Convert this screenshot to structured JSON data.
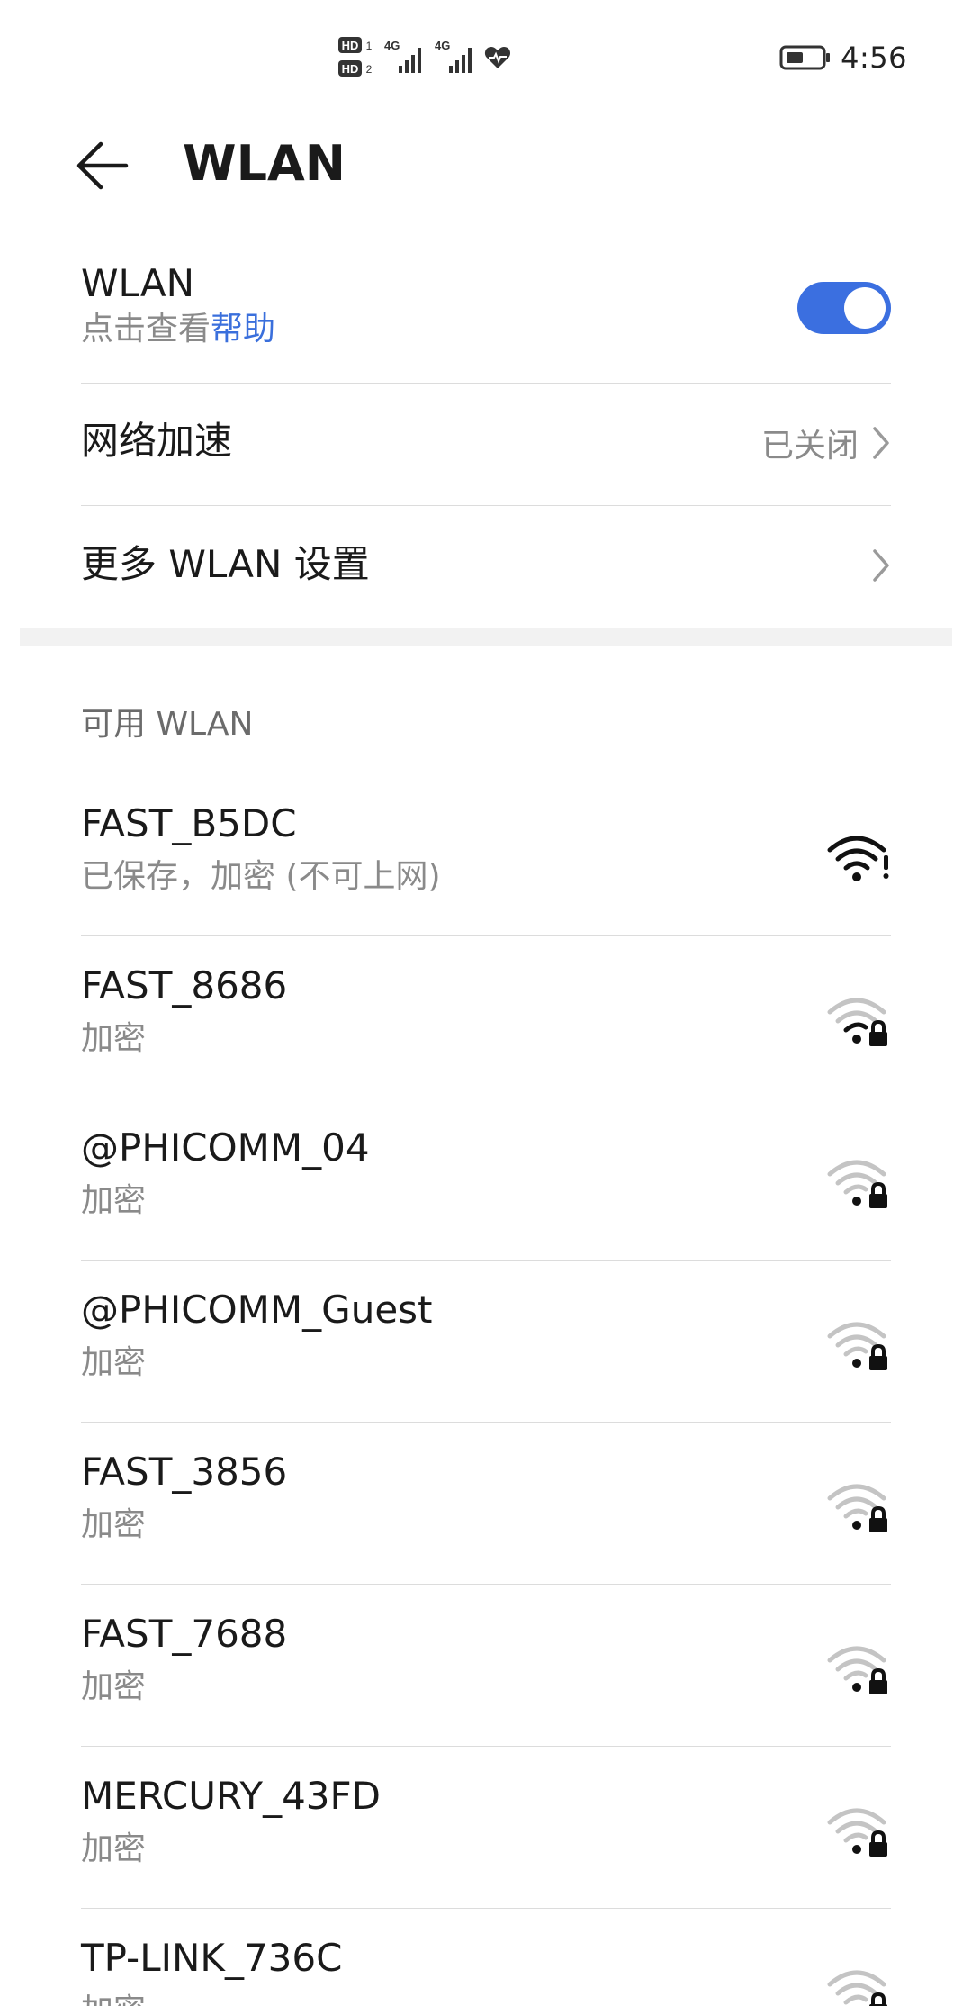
{
  "status_bar": {
    "time": "4:56",
    "hd1": "HD",
    "hd2": "HD",
    "net1": "4G",
    "net2": "4G",
    "icons": [
      "hd-icon",
      "signal-4g-icon",
      "signal-4g-icon",
      "heart-health-icon",
      "battery-icon"
    ]
  },
  "header": {
    "title": "WLAN"
  },
  "wlan_toggle": {
    "title": "WLAN",
    "subtitle_prefix": "点击查看",
    "help_link": "帮助",
    "enabled": true
  },
  "network_accel": {
    "title": "网络加速",
    "value": "已关闭"
  },
  "more_settings": {
    "title": "更多 WLAN 设置"
  },
  "available": {
    "header": "可用 WLAN",
    "networks": [
      {
        "name": "FAST_B5DC",
        "status": "已保存，加密 (不可上网)",
        "icon": "wifi-no-internet-icon",
        "strength": 1.0,
        "locked": false
      },
      {
        "name": "FAST_8686",
        "status": "加密",
        "icon": "wifi-locked-icon",
        "strength": 0.5,
        "locked": true
      },
      {
        "name": "@PHICOMM_04",
        "status": "加密",
        "icon": "wifi-locked-icon",
        "strength": 0.25,
        "locked": true
      },
      {
        "name": "@PHICOMM_Guest",
        "status": "加密",
        "icon": "wifi-locked-icon",
        "strength": 0.25,
        "locked": true
      },
      {
        "name": "FAST_3856",
        "status": "加密",
        "icon": "wifi-locked-icon",
        "strength": 0.25,
        "locked": true
      },
      {
        "name": "FAST_7688",
        "status": "加密",
        "icon": "wifi-locked-icon",
        "strength": 0.25,
        "locked": true
      },
      {
        "name": "MERCURY_43FD",
        "status": "加密",
        "icon": "wifi-locked-icon",
        "strength": 0.25,
        "locked": true
      },
      {
        "name": "TP-LINK_736C",
        "status": "加密",
        "icon": "wifi-locked-icon",
        "strength": 0.25,
        "locked": true
      }
    ]
  },
  "colors": {
    "accent": "#3b6fe0",
    "link": "#3a6fdc",
    "secondary_text": "#8a8a8a",
    "divider": "#dcdcdc"
  }
}
